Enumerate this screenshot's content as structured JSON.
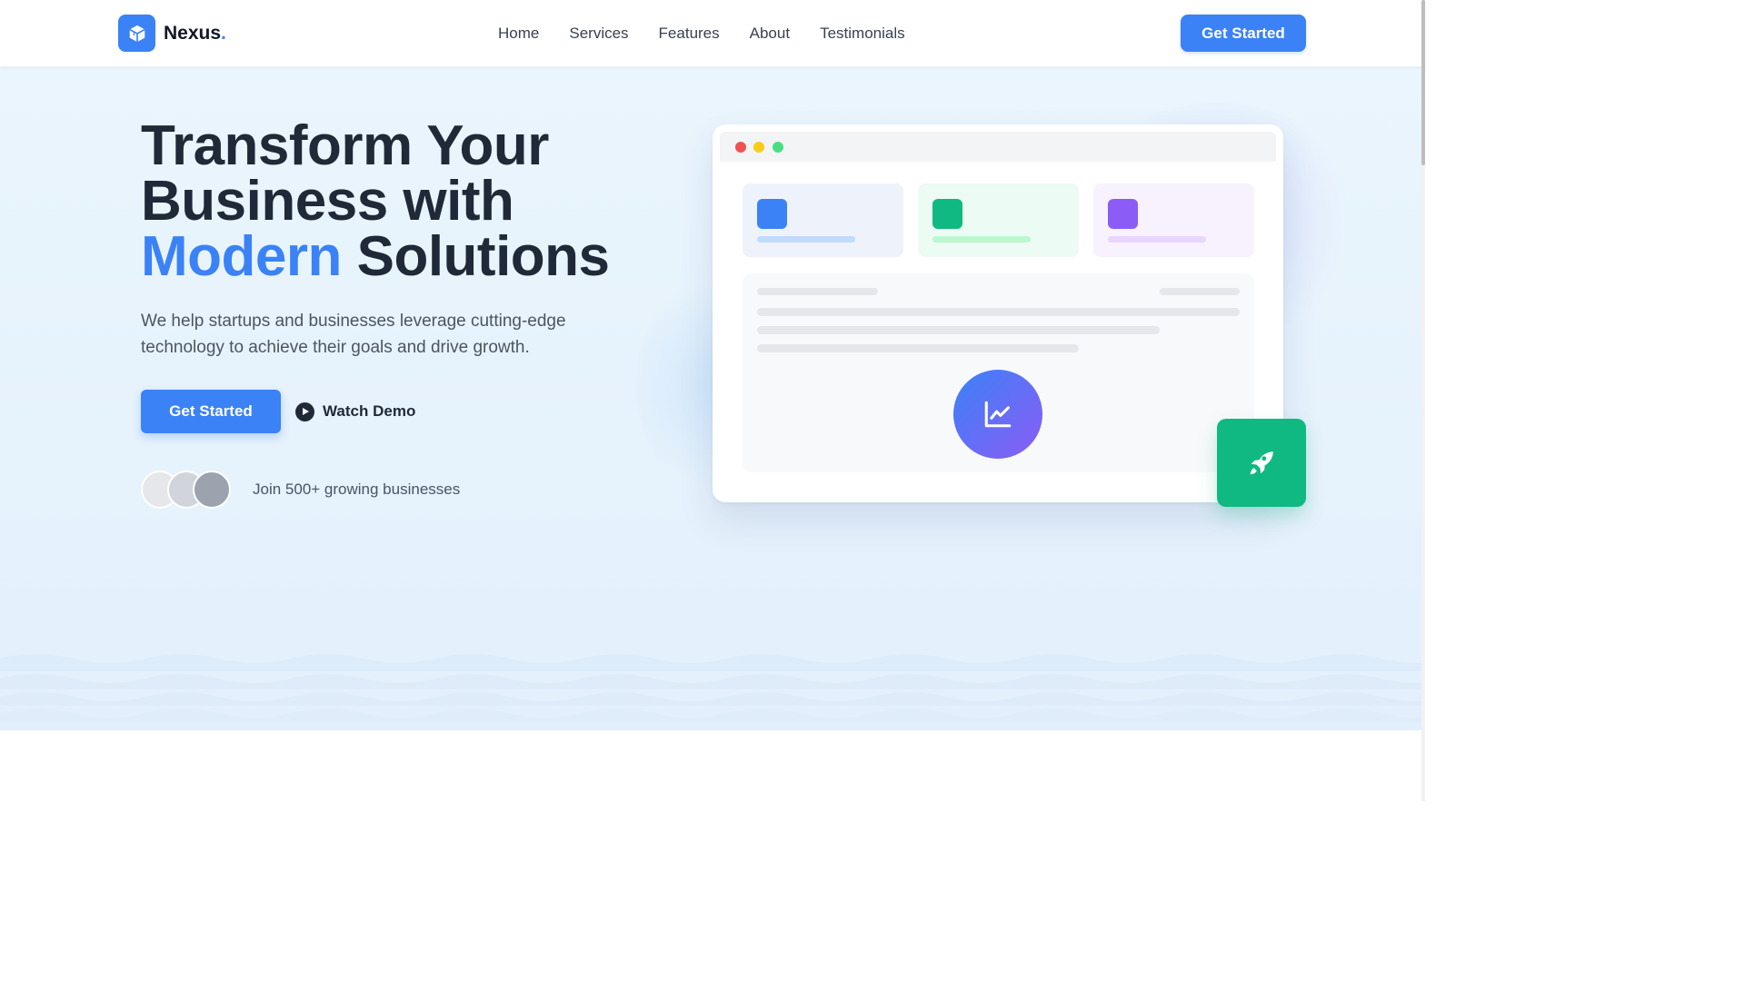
{
  "header": {
    "brand": "Nexus",
    "brand_dot": ".",
    "logo_icon": "cube-icon",
    "nav": [
      "Home",
      "Services",
      "Features",
      "About",
      "Testimonials"
    ],
    "cta": "Get Started"
  },
  "hero": {
    "title_line1": "Transform Your",
    "title_line2": "Business with",
    "title_accent": "Modern",
    "title_rest": "Solutions",
    "description": "We help startups and businesses leverage cutting-edge technology to achieve their goals and drive growth.",
    "primary_button": "Get Started",
    "secondary_button": "Watch Demo",
    "social_proof": "Join 500+ growing businesses"
  },
  "mockup": {
    "window_dots": [
      "#ef5350",
      "#facc15",
      "#4ade80"
    ],
    "cards": [
      {
        "bg": "#eef3fb",
        "square": "#3b82f6",
        "line": "#bfdbfe"
      },
      {
        "bg": "#ecfbf3",
        "square": "#10b981",
        "line": "#bbf7d0"
      },
      {
        "bg": "#f7f2fd",
        "square": "#8b5cf6",
        "line": "#e9d5ff"
      }
    ],
    "center_icon": "chart-line-icon",
    "floating_icon": "rocket-icon"
  },
  "colors": {
    "accent": "#3b82f6",
    "success": "#10b981",
    "purple": "#8b5cf6",
    "text": "#1f2937"
  }
}
